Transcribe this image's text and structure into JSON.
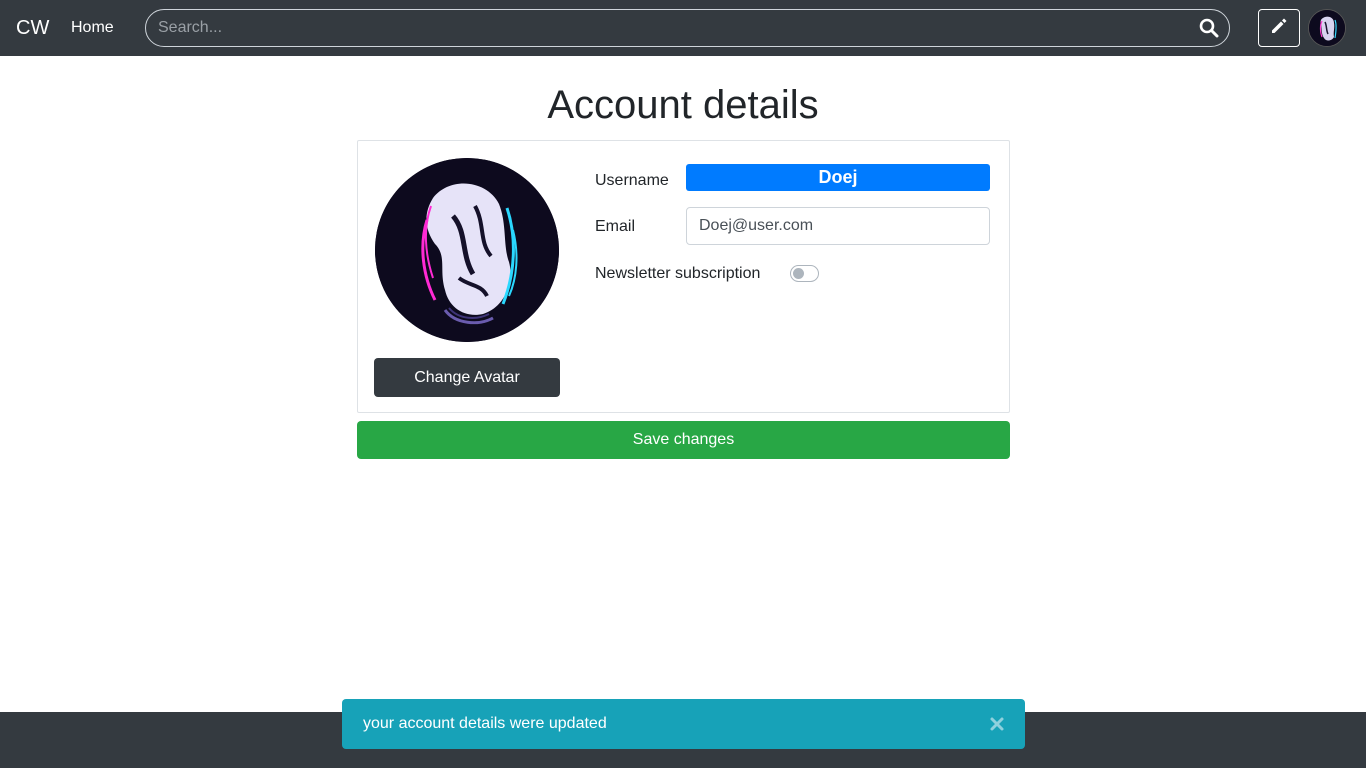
{
  "navbar": {
    "brand": "CW",
    "home_label": "Home",
    "search_placeholder": "Search...",
    "icons": {
      "search": "search-icon",
      "edit": "pencil-icon",
      "avatar": "user-avatar"
    }
  },
  "page": {
    "title": "Account details"
  },
  "profile": {
    "change_avatar_label": "Change Avatar",
    "username_label": "Username",
    "username_value": "Doej",
    "email_label": "Email",
    "email_value": "Doej@user.com",
    "newsletter_label": "Newsletter subscription",
    "newsletter_enabled": false
  },
  "actions": {
    "save_label": "Save changes"
  },
  "toast": {
    "message": "your account details were updated",
    "close_icon": "close-icon"
  },
  "colors": {
    "navbar": "#343a40",
    "primary": "#007bff",
    "success": "#28a745",
    "info": "#17a2b8"
  }
}
